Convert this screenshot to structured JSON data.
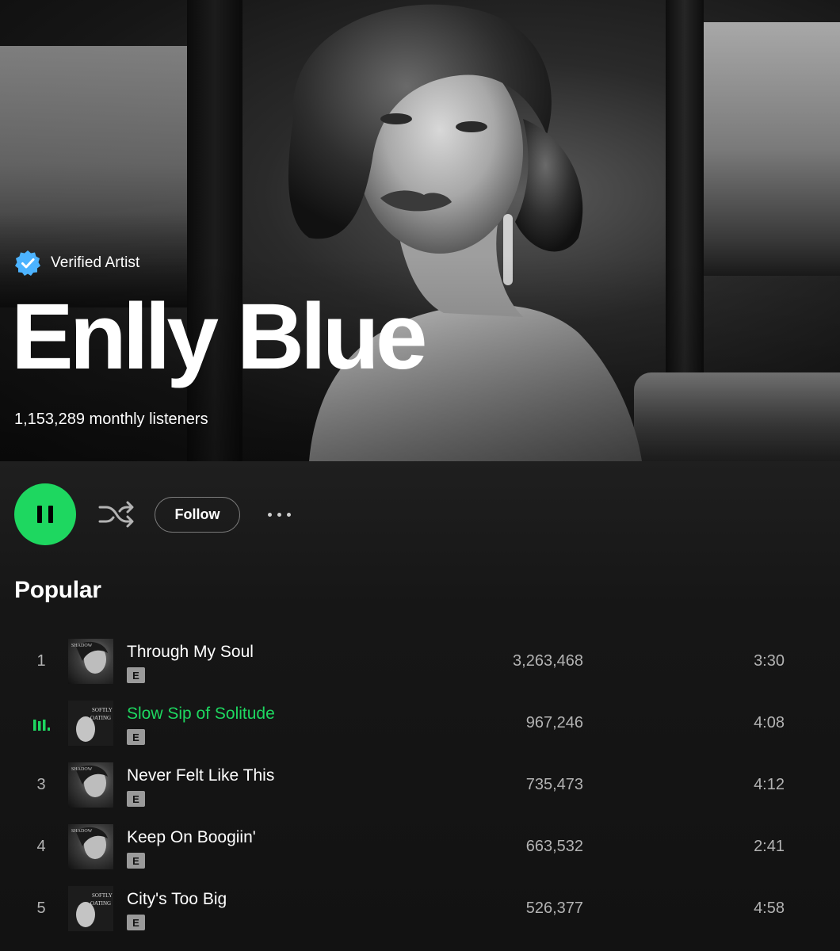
{
  "hero": {
    "verified_label": "Verified Artist",
    "artist_name": "Enlly Blue",
    "monthly_listeners": "1,153,289 monthly listeners"
  },
  "controls": {
    "play_state": "playing",
    "follow_label": "Follow"
  },
  "popular": {
    "title": "Popular",
    "tracks": [
      {
        "rank": "1",
        "title": "Through My Soul",
        "explicit": "E",
        "plays": "3,263,468",
        "duration": "3:30",
        "playing": false
      },
      {
        "rank": "2",
        "title": "Slow Sip of Solitude",
        "explicit": "E",
        "plays": "967,246",
        "duration": "4:08",
        "playing": true
      },
      {
        "rank": "3",
        "title": "Never Felt Like This",
        "explicit": "E",
        "plays": "735,473",
        "duration": "4:12",
        "playing": false
      },
      {
        "rank": "4",
        "title": "Keep On Boogiin'",
        "explicit": "E",
        "plays": "663,532",
        "duration": "2:41",
        "playing": false
      },
      {
        "rank": "5",
        "title": "City's Too Big",
        "explicit": "E",
        "plays": "526,377",
        "duration": "4:58",
        "playing": false
      }
    ]
  },
  "colors": {
    "accent_green": "#1ed760",
    "verified_blue": "#4cb3ff",
    "background": "#121212",
    "secondary_text": "#b3b3b3"
  },
  "icons": {
    "verified": "verified-badge-icon",
    "play": "pause-icon",
    "shuffle": "shuffle-icon",
    "more": "more-options-icon",
    "now_playing": "equalizer-icon"
  }
}
